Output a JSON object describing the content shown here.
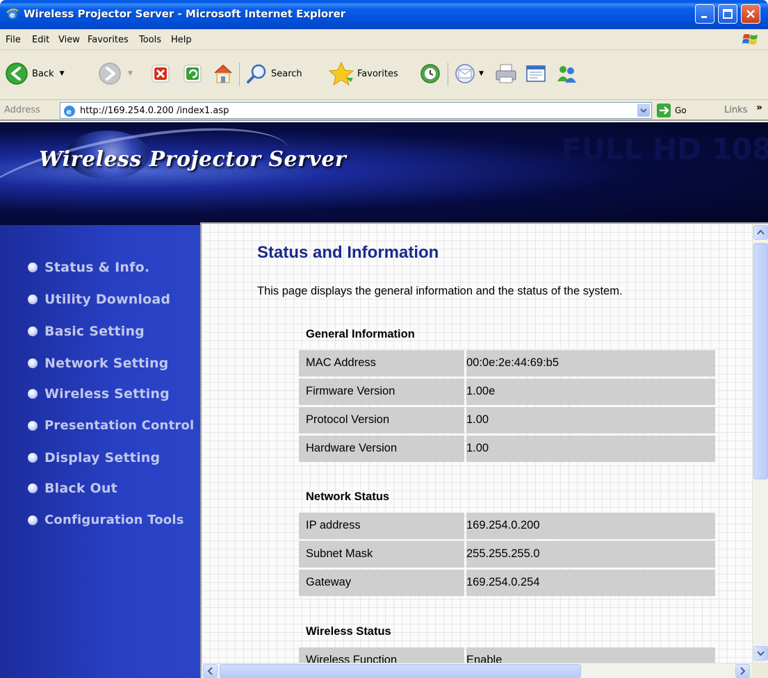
{
  "window": {
    "title": "Wireless Projector Server - Microsoft Internet Explorer",
    "icons": {
      "app": "ie-icon",
      "minimize": "minimize-icon",
      "maximize": "maximize-icon",
      "close": "close-icon"
    }
  },
  "menu": [
    "File",
    "Edit",
    "View",
    "Favorites",
    "Tools",
    "Help"
  ],
  "toolbar": {
    "back": "Back",
    "search": "Search",
    "favorites": "Favorites"
  },
  "address": {
    "label": "Address",
    "url": "http://169.254.0.200 /index1.asp",
    "go": "Go",
    "links": "Links",
    "chevron": "»"
  },
  "banner": {
    "title": "Wireless Projector Server",
    "watermark": "FULL HD 108"
  },
  "sidebar": {
    "items": [
      "Status & Info.",
      "Utility Download",
      "Basic Setting",
      "Network Setting",
      "Wireless Setting",
      "Presentation Control",
      "Display Setting",
      "Black Out",
      "Configuration Tools"
    ]
  },
  "main": {
    "title": "Status and Information",
    "description": "This page displays the general information and the status of the system.",
    "general": {
      "heading": "General Information",
      "rows": [
        {
          "key": "MAC Address",
          "value": "00:0e:2e:44:69:b5"
        },
        {
          "key": "Firmware Version",
          "value": "1.00e"
        },
        {
          "key": "Protocol Version",
          "value": "1.00"
        },
        {
          "key": "Hardware Version",
          "value": "1.00"
        }
      ]
    },
    "network": {
      "heading": "Network Status",
      "rows": [
        {
          "key": "IP address",
          "value": "169.254.0.200"
        },
        {
          "key": "Subnet Mask",
          "value": "255.255.255.0"
        },
        {
          "key": "Gateway",
          "value": "169.254.0.254"
        }
      ]
    },
    "wireless": {
      "heading": "Wireless Status",
      "rows": [
        {
          "key": "Wireless Function",
          "value": "Enable"
        }
      ]
    }
  }
}
